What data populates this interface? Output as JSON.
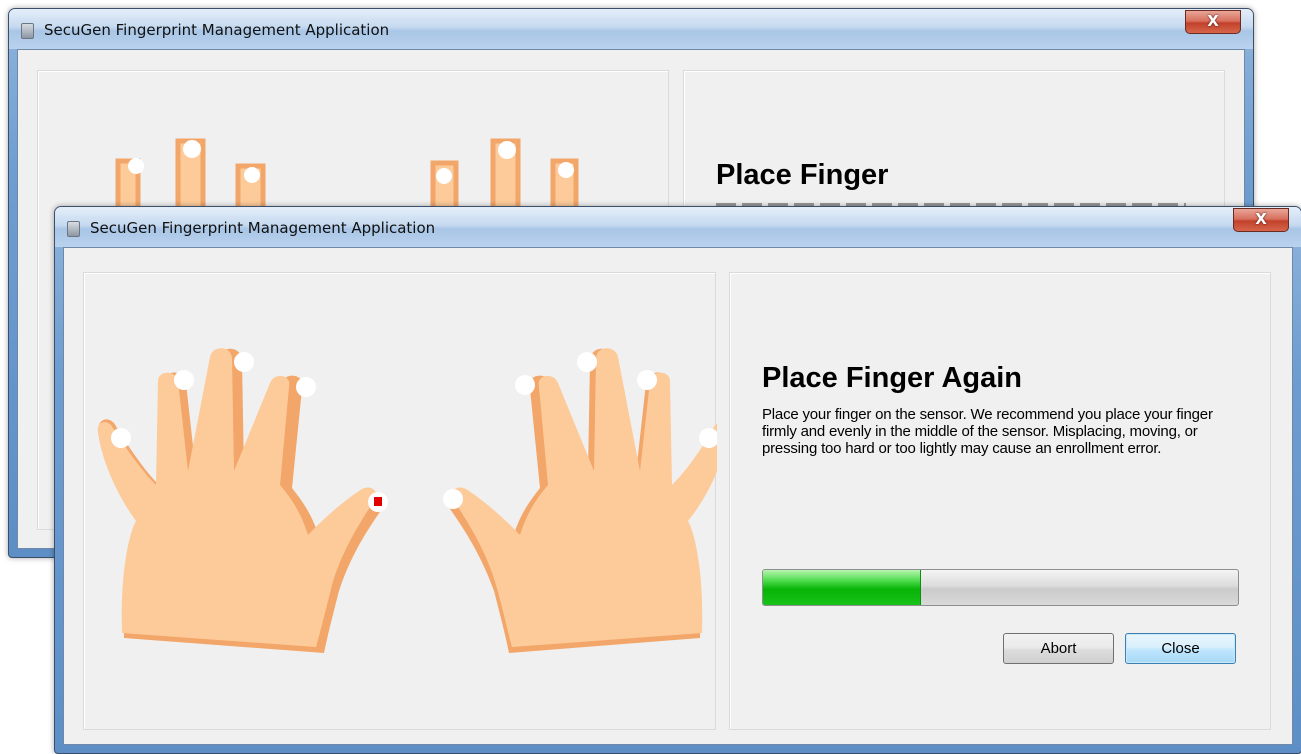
{
  "back_window": {
    "title": "SecuGen Fingerprint Management Application",
    "close_label": "X",
    "heading": "Place Finger"
  },
  "front_window": {
    "title": "SecuGen Fingerprint Management Application",
    "close_label": "X",
    "heading": "Place Finger Again",
    "instructions": "Place your finger on the sensor. We recommend you place your finger firmly and evenly in the middle of the sensor. Misplacing, moving, or pressing too hard or too lightly may cause an enrollment error.",
    "progress": {
      "fraction": 0.33
    },
    "buttons": {
      "abort": "Abort",
      "close": "Close"
    },
    "selected_finger": "left-thumb",
    "colors": {
      "skin": "#fdcb9a",
      "skin_shadow": "#f2a669",
      "fingertip": "#ffffff",
      "selected_marker": "#e00000",
      "progress_fill": "#07b407"
    }
  }
}
